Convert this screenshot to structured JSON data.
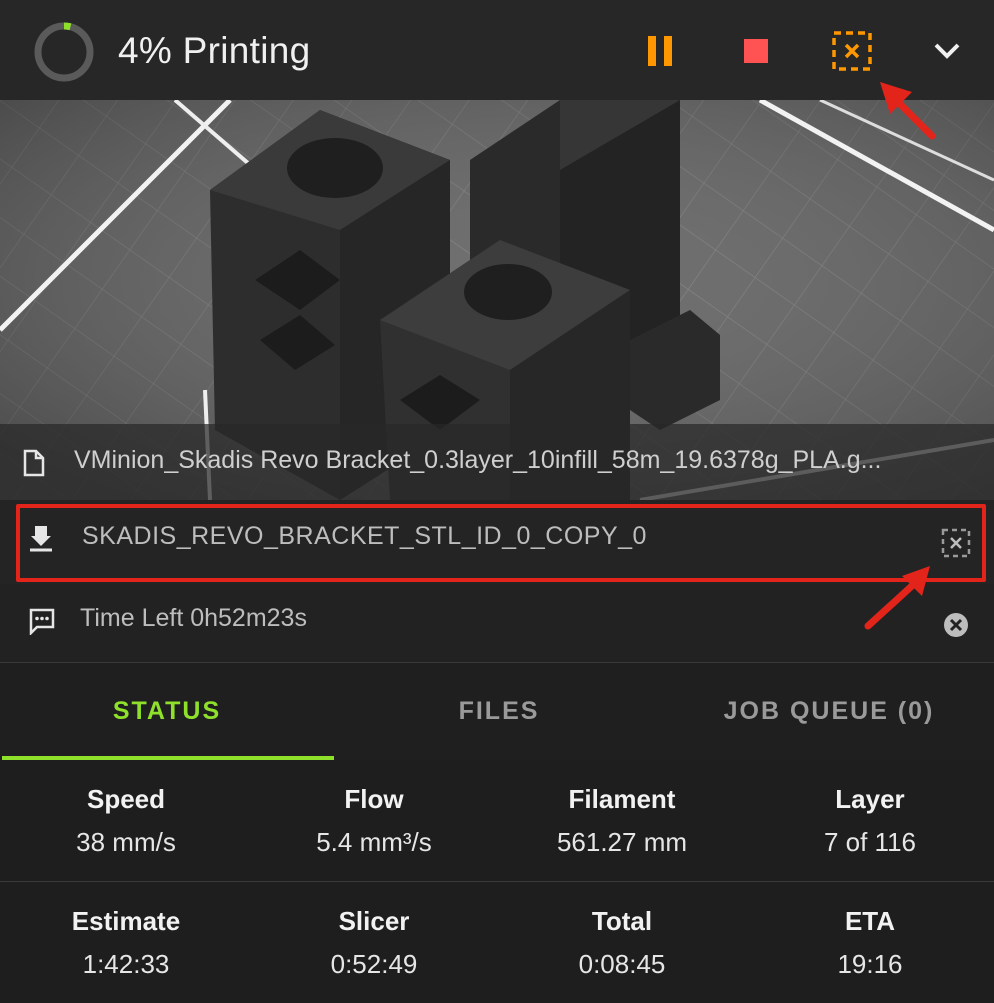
{
  "header": {
    "title": "4% Printing",
    "progress": 0.04,
    "progress_color": "#8fe02a",
    "accent_color": "#ff9800",
    "stop_color": "#ff5252",
    "icons": [
      "pause-icon",
      "stop-icon",
      "exclude-object-icon",
      "chevron-down-icon"
    ]
  },
  "file": {
    "name": "VMinion_Skadis Revo Bracket_0.3layer_10infill_58m_19.6378g_PLA.g..."
  },
  "object": {
    "name": "SKADIS_REVO_BRACKET_STL_ID_0_COPY_0"
  },
  "message": {
    "text": "Time Left 0h52m23s"
  },
  "tabs": [
    {
      "label": "STATUS",
      "active": true
    },
    {
      "label": "FILES",
      "active": false
    },
    {
      "label": "JOB QUEUE (0)",
      "active": false
    }
  ],
  "stats": {
    "row1": [
      {
        "label": "Speed",
        "value": "38 mm/s"
      },
      {
        "label": "Flow",
        "value": "5.4 mm³/s"
      },
      {
        "label": "Filament",
        "value": "561.27 mm"
      },
      {
        "label": "Layer",
        "value": "7 of 116"
      }
    ],
    "row2": [
      {
        "label": "Estimate",
        "value": "1:42:33"
      },
      {
        "label": "Slicer",
        "value": "0:52:49"
      },
      {
        "label": "Total",
        "value": "0:08:45"
      },
      {
        "label": "ETA",
        "value": "19:16"
      }
    ]
  },
  "annotation_color": "#e3241b"
}
